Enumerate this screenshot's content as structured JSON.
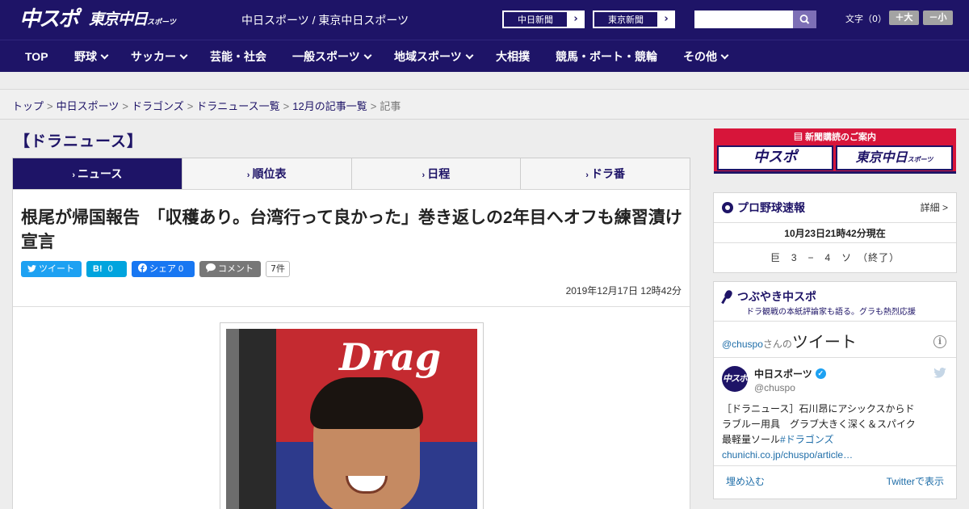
{
  "header": {
    "logo_chuspo": "中スポ",
    "logo_tokyo": "東京中日",
    "logo_tokyo_sub": "スポーツ",
    "site_title": "中日スポーツ / 東京中日スポーツ",
    "btn_chunichi": "中日新聞",
    "btn_tokyo": "東京新聞",
    "fontsize_label": "文字（0）",
    "fontsize_up": "＋大",
    "fontsize_down": "－小"
  },
  "nav": {
    "items": [
      {
        "label": "TOP"
      },
      {
        "label": "野球"
      },
      {
        "label": "サッカー"
      },
      {
        "label": "芸能・社会"
      },
      {
        "label": "一般スポーツ"
      },
      {
        "label": "地域スポーツ"
      },
      {
        "label": "大相撲"
      },
      {
        "label": "競馬・ボート・競輪"
      },
      {
        "label": "その他"
      }
    ]
  },
  "breadcrumb": {
    "items": [
      "トップ",
      "中日スポーツ",
      "ドラゴンズ",
      "ドラニュース一覧",
      "12月の記事一覧"
    ],
    "current": "記事",
    "separator": ">"
  },
  "section": {
    "title": "【ドラニュース】"
  },
  "tabs": [
    {
      "label": "ニュース",
      "active": true
    },
    {
      "label": "順位表",
      "active": false
    },
    {
      "label": "日程",
      "active": false
    },
    {
      "label": "ドラ番",
      "active": false
    }
  ],
  "article": {
    "headline": "根尾が帰国報告　「収穫あり。台湾行って良かった」巻き返しの2年目へオフも練習漬け宣言",
    "share": {
      "tweet": "ツイート",
      "hatena_label": "B!",
      "hatena_count": "0",
      "facebook": "シェア 0",
      "comment": "コメント",
      "comment_count": "7件"
    },
    "datetime": "2019年12月17日 12時42分",
    "photo_text": "Drag"
  },
  "sidebar": {
    "promo_title": "新聞購読のご案内",
    "promo_chuspo": "中スポ",
    "promo_tokyo": "東京中日",
    "promo_tokyo_sub": "スポーツ",
    "baseball": {
      "title": "プロ野球速報",
      "detail": "詳細 >",
      "stamp": "10月23日21時42分現在",
      "score": "巨　3　−　4　ソ　（終了）"
    },
    "twitter": {
      "title": "つぶやき中スポ",
      "subtitle": "ドラ観戦の本紙評論家も語る。グラも熱烈応援",
      "feed_handle": "@chuspo",
      "feed_san": "さんの",
      "feed_tweet": "ツイート",
      "user_name": "中日スポーツ",
      "user_handle": "@chuspo",
      "avatar_text": "中スポ",
      "body": "［ドラニュース］石川昂にアシックスからドラブルー用具　グラブ大きく深く＆スパイク最軽量ソール",
      "body_link": "#ドラゴンズchunichi.co.jp/chuspo/article…",
      "embed": "埋め込む",
      "view": "Twitterで表示"
    }
  },
  "colors": {
    "brand_navy": "#1e1467",
    "promo_red": "#d7153a",
    "twitter_blue": "#1da1f2"
  }
}
